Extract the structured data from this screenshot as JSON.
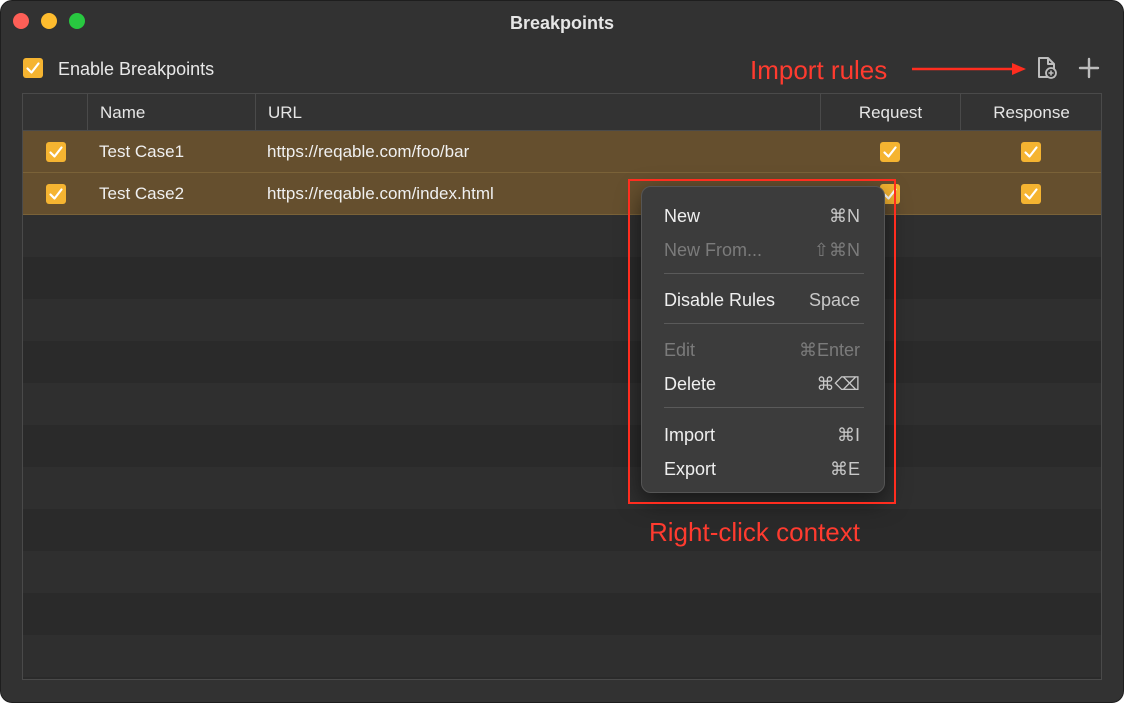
{
  "window": {
    "title": "Breakpoints"
  },
  "toolbar": {
    "enable_label": "Enable Breakpoints",
    "enabled": true,
    "import_icon": "import-document-icon",
    "add_icon": "plus-icon"
  },
  "table": {
    "columns": [
      "Name",
      "URL",
      "Request",
      "Response"
    ],
    "rows": [
      {
        "enabled": true,
        "name": "Test Case1",
        "url": "https://reqable.com/foo/bar",
        "request": true,
        "response": true
      },
      {
        "enabled": true,
        "name": "Test Case2",
        "url": "https://reqable.com/index.html",
        "request": true,
        "response": true
      }
    ]
  },
  "context_menu": {
    "items": [
      {
        "label": "New",
        "shortcut": "⌘N",
        "disabled": false
      },
      {
        "label": "New From...",
        "shortcut": "⇧⌘N",
        "disabled": true
      },
      {
        "label": "Disable Rules",
        "shortcut": "Space",
        "disabled": false
      },
      {
        "label": "Edit",
        "shortcut": "⌘Enter",
        "disabled": true
      },
      {
        "label": "Delete",
        "shortcut": "⌘⌫",
        "disabled": false
      },
      {
        "label": "Import",
        "shortcut": "⌘I",
        "disabled": false
      },
      {
        "label": "Export",
        "shortcut": "⌘E",
        "disabled": false
      }
    ]
  },
  "annotations": {
    "import_rules": "Import rules",
    "right_click_context": "Right-click context"
  },
  "colors": {
    "accent": "#f5b431",
    "annotation": "#ff2d1f",
    "row_highlight": "#654f2e"
  }
}
